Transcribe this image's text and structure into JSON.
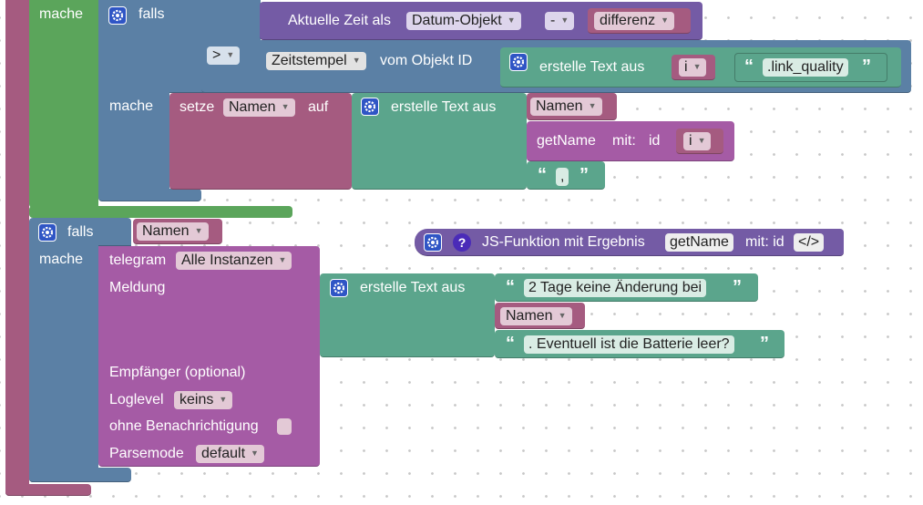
{
  "outer": {
    "mache_label": "mache"
  },
  "inner_if": {
    "falls_label": "falls",
    "time_label": "Aktuelle Zeit als",
    "time_format": "Datum-Objekt",
    "minus_op": "-",
    "differenz_var": "differenz",
    "compare_op": ">",
    "zeitstempel_option": "Zeitstempel",
    "vom_objekt_label": "vom Objekt ID",
    "create_text_label": "erstelle Text aus",
    "var_i": "i",
    "link_quality_text": ".link_quality",
    "mache_label": "mache",
    "setze_label": "setze",
    "namen_var": "Namen",
    "auf_label": "auf",
    "create_text_label2": "erstelle Text aus",
    "namen_var2": "Namen",
    "getname_label": "getName",
    "mit_label": "mit:",
    "id_label": "id",
    "var_i2": "i",
    "comma_text": ","
  },
  "second_if": {
    "falls_label": "falls",
    "condition_var": "Namen",
    "mache_label": "mache"
  },
  "telegram": {
    "telegram_label": "telegram",
    "instance_option": "Alle Instanzen",
    "meldung_label": "Meldung",
    "create_text_label": "erstelle Text aus",
    "text1": "2 Tage keine Änderung bei",
    "namen_var": "Namen",
    "text2": ". Eventuell ist die Batterie leer?",
    "empfaenger_label": "Empfänger (optional)",
    "loglevel_label": "Loglevel",
    "loglevel_option": "keins",
    "ohne_label": "ohne Benachrichtigung",
    "parsemode_label": "Parsemode",
    "parsemode_option": "default"
  },
  "js_function": {
    "question": "?",
    "label": "JS-Funktion mit Ergebnis",
    "name": "getName",
    "mit_label": "mit: id",
    "code_button": "</>"
  },
  "colors": {
    "loop_pink": "#a55b80",
    "if_green": "#5ba55b",
    "logic_blue": "#5b80a5",
    "telegram_purple": "#a55ba5",
    "text_teal": "#5ba58c",
    "function_violet": "#745ba5",
    "gear_blue": "#2f55c5"
  }
}
